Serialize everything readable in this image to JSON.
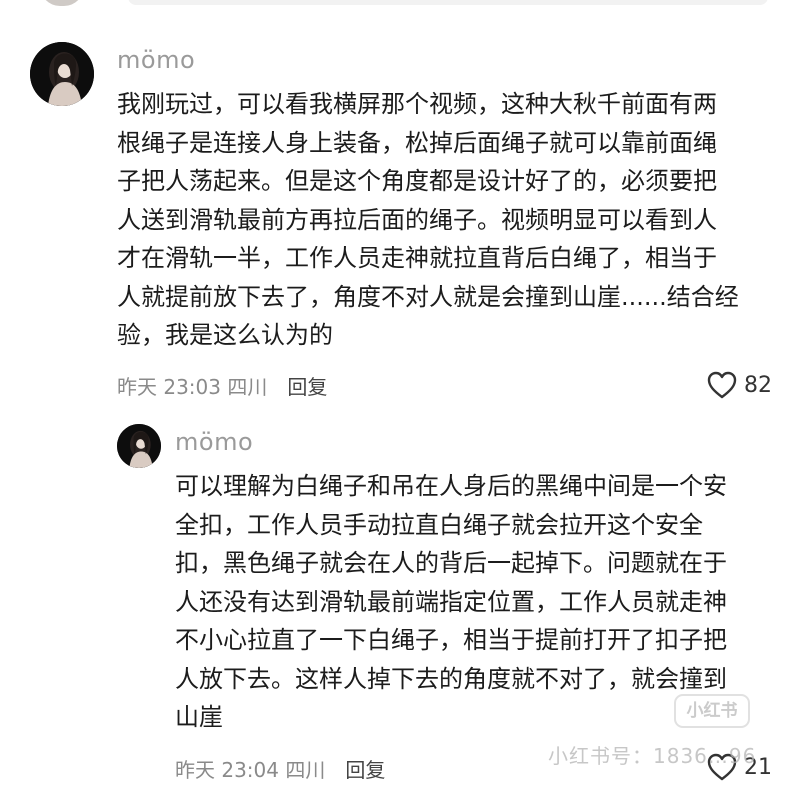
{
  "comments": [
    {
      "username": "mömo",
      "text": "我刚玩过，可以看我横屏那个视频，这种大秋千前面有两\n根绳子是连接人身上装备，松掉后面绳子就可以靠前面绳\n子把人荡起来。但是这个角度都是设计好了的，必须要把\n人送到滑轨最前方再拉后面的绳子。视频明显可以看到人\n才在滑轨一半，工作人员走神就拉直背后白绳了，相当于\n人就提前放下去了，角度不对人就是会撞到山崖......结合经\n验，我是这么认为的",
      "time": "昨天 23:03 四川",
      "reply_label": "回复",
      "like_count": "82"
    },
    {
      "username": "mömo",
      "text": "可以理解为白绳子和吊在人身后的黑绳中间是一个安\n全扣，工作人员手动拉直白绳子就会拉开这个安全\n扣，黑色绳子就会在人的背后一起掉下。问题就在于\n人还没有达到滑轨最前端指定位置，工作人员就走神\n不小心拉直了一下白绳子，相当于提前打开了扣子把\n人放下去。这样人掉下去的角度就不对了，就会撞到\n山崖",
      "time": "昨天 23:04 四川",
      "reply_label": "回复",
      "like_count": "21"
    }
  ],
  "watermark": {
    "logo_text": "小红书",
    "id_text": "小红书号：1836…96"
  },
  "icons": {
    "like": "heart-outline-icon",
    "avatar": "user-avatar"
  },
  "colors": {
    "username": "#9a9a9a",
    "text": "#1c1c1c",
    "meta": "#8a8a8a"
  }
}
